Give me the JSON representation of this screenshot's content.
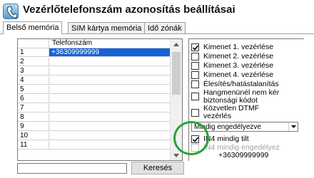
{
  "window": {
    "title": "Vezérlőtelefonszám azonosítás beállításai",
    "icon": "phone-handset-icon"
  },
  "tabs": [
    {
      "label": "Belső memória",
      "active": true
    },
    {
      "label": "SIM kártya memória",
      "active": false
    },
    {
      "label": "Idő zónák",
      "active": false
    }
  ],
  "grid": {
    "column_header": "Telefonszám",
    "rows": [
      {
        "num": "1",
        "number": "+36309999999",
        "selected": true
      },
      {
        "num": "2",
        "number": ""
      },
      {
        "num": "3",
        "number": ""
      },
      {
        "num": "4",
        "number": ""
      },
      {
        "num": "5",
        "number": ""
      },
      {
        "num": "6",
        "number": ""
      },
      {
        "num": "7",
        "number": ""
      },
      {
        "num": "8",
        "number": ""
      },
      {
        "num": "9",
        "number": ""
      },
      {
        "num": "10",
        "number": ""
      },
      {
        "num": "11",
        "number": ""
      }
    ]
  },
  "search": {
    "value": "",
    "button_label": "Keresés"
  },
  "options": {
    "kimenet1": {
      "label": "Kimenet 1. vezérlése",
      "checked": true
    },
    "kimenet2": {
      "label": "Kimenet 2. vezérlése",
      "checked": false
    },
    "kimenet3": {
      "label": "Kimenet 3. vezérlése",
      "checked": false
    },
    "kimenet4": {
      "label": "Kimenet 4. vezérlése",
      "checked": false
    },
    "elesites": {
      "label": "Élesítés/hatástalanítás",
      "checked": false
    },
    "hangmenu_line1": "Hangmenünél nem kér",
    "hangmenu_line2": "biztonsági kódot",
    "dtmf_line1": "Közvetlen DTMF",
    "dtmf_line2": "vezérlés",
    "dropdown_value": "Mindig engedélyezve",
    "in4_tilt": {
      "label": "IN4 mindig tilt",
      "checked": true
    },
    "in4_enged": {
      "label": "IN4 mindig engedélyez",
      "checked": false
    },
    "in4_number": "+36309999999"
  },
  "colors": {
    "selection": "#1463d8",
    "highlight_ring": "#2ea03a"
  }
}
